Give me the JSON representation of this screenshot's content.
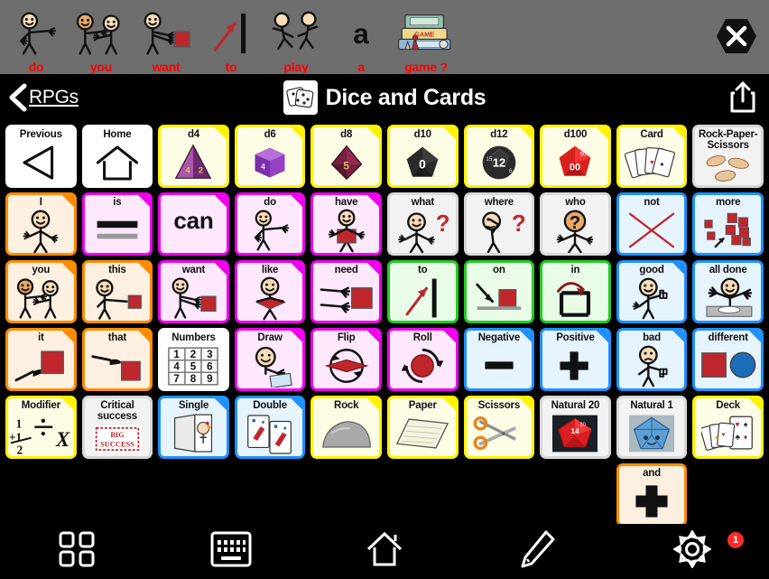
{
  "message_bar": {
    "words": [
      {
        "label": "do",
        "icon": "person-pointing-icon"
      },
      {
        "label": "you",
        "icon": "two-people-pointing-icon"
      },
      {
        "label": "want",
        "icon": "person-reaching-object-icon"
      },
      {
        "label": "to",
        "icon": "arrow-to-line-icon"
      },
      {
        "label": "play",
        "icon": "two-people-running-icon"
      },
      {
        "label": "a",
        "icon": "letter-a-icon"
      },
      {
        "label": "game ?",
        "icon": "board-games-stack-icon"
      }
    ],
    "close_button": "close-icon",
    "background_color": "#6e6e6e",
    "text_color": "#ff0000"
  },
  "navbar": {
    "back_label": "RPGs",
    "title": "Dice and Cards",
    "title_icon": "dice-icon",
    "share_icon": "share-icon"
  },
  "grid": {
    "rows": [
      [
        {
          "label": "Previous",
          "icon": "left-triangle-icon",
          "border": "#ffffff",
          "fill": "#ffffff",
          "fold": null
        },
        {
          "label": "Home",
          "icon": "house-outline-icon",
          "border": "#ffffff",
          "fill": "#ffffff",
          "fold": null
        },
        {
          "label": "d4",
          "icon": "d4-die-icon",
          "border": "#fff200",
          "fill": "#fdfce4",
          "fold": "#fff200"
        },
        {
          "label": "d6",
          "icon": "d6-die-icon",
          "border": "#fff200",
          "fill": "#fdfce4",
          "fold": "#fff200"
        },
        {
          "label": "d8",
          "icon": "d8-die-icon",
          "border": "#fff200",
          "fill": "#fdfce4",
          "fold": "#fff200"
        },
        {
          "label": "d10",
          "icon": "d10-die-icon",
          "border": "#fff200",
          "fill": "#fdfce4",
          "fold": "#fff200"
        },
        {
          "label": "d12",
          "icon": "d12-die-icon",
          "border": "#fff200",
          "fill": "#fdfce4",
          "fold": "#fff200"
        },
        {
          "label": "d100",
          "icon": "d100-die-icon",
          "border": "#fff200",
          "fill": "#fdfce4",
          "fold": "#fff200"
        },
        {
          "label": "Card",
          "icon": "playing-cards-fan-icon",
          "border": "#fff200",
          "fill": "#fdfce4",
          "fold": "#fff200"
        },
        {
          "label": "Rock-Paper-\nScissors",
          "icon": "hands-rps-icon",
          "border": "#d8d8d8",
          "fill": "#f2f2f2",
          "fold": null
        }
      ],
      [
        {
          "label": "I",
          "icon": "person-self-icon",
          "border": "#ff8c00",
          "fill": "#fdf0e0",
          "fold": "#ff8c00"
        },
        {
          "label": "is",
          "icon": "equals-sign-icon",
          "border": "#ee00ee",
          "fill": "#fde8fd",
          "fold": "#ee00ee"
        },
        {
          "label": "",
          "text": "can",
          "icon": "text-can-icon",
          "border": "#ee00ee",
          "fill": "#fde8fd",
          "fold": "#ee00ee"
        },
        {
          "label": "do",
          "icon": "person-pointing-icon",
          "border": "#ee00ee",
          "fill": "#fde8fd",
          "fold": "#ee00ee"
        },
        {
          "label": "have",
          "icon": "person-holding-block-icon",
          "border": "#ee00ee",
          "fill": "#fde8fd",
          "fold": "#ee00ee"
        },
        {
          "label": "what",
          "icon": "person-shrug-question-icon",
          "border": "#d8d8d8",
          "fill": "#f2f2f2",
          "fold": null
        },
        {
          "label": "where",
          "icon": "person-looking-question-icon",
          "border": "#d8d8d8",
          "fill": "#f2f2f2",
          "fold": null
        },
        {
          "label": "who",
          "icon": "person-question-head-icon",
          "border": "#d8d8d8",
          "fill": "#f2f2f2",
          "fold": null
        },
        {
          "label": "not",
          "icon": "red-x-icon",
          "border": "#1e90ff",
          "fill": "#e6f4ff",
          "fold": null
        },
        {
          "label": "more",
          "icon": "many-blocks-icon",
          "border": "#1e90ff",
          "fill": "#e6f4ff",
          "fold": null
        }
      ],
      [
        {
          "label": "you",
          "icon": "two-people-pointing-icon",
          "border": "#ff8c00",
          "fill": "#fdf0e0",
          "fold": "#ff8c00"
        },
        {
          "label": "this",
          "icon": "person-pointing-block-icon",
          "border": "#ff8c00",
          "fill": "#fdf0e0",
          "fold": "#ff8c00"
        },
        {
          "label": "want",
          "icon": "person-reaching-object-icon",
          "border": "#ee00ee",
          "fill": "#fde8fd",
          "fold": "#ee00ee"
        },
        {
          "label": "like",
          "icon": "person-hugging-block-icon",
          "border": "#ee00ee",
          "fill": "#fde8fd",
          "fold": "#ee00ee"
        },
        {
          "label": "need",
          "icon": "hands-reaching-block-icon",
          "border": "#ee00ee",
          "fill": "#fde8fd",
          "fold": "#ee00ee"
        },
        {
          "label": "to",
          "icon": "arrow-to-line-icon",
          "border": "#22cc22",
          "fill": "#e8fce8",
          "fold": null
        },
        {
          "label": "on",
          "icon": "arrow-on-block-icon",
          "border": "#22cc22",
          "fill": "#e8fce8",
          "fold": null
        },
        {
          "label": "in",
          "icon": "arrow-into-container-icon",
          "border": "#22cc22",
          "fill": "#e8fce8",
          "fold": null
        },
        {
          "label": "good",
          "icon": "person-thumbs-up-icon",
          "border": "#1e90ff",
          "fill": "#e6f4ff",
          "fold": "#1e90ff"
        },
        {
          "label": "all done",
          "icon": "person-empty-plate-icon",
          "border": "#1e90ff",
          "fill": "#e6f4ff",
          "fold": null
        }
      ],
      [
        {
          "label": "it",
          "icon": "hand-pointing-block-icon",
          "border": "#ff8c00",
          "fill": "#fdf0e0",
          "fold": "#ff8c00"
        },
        {
          "label": "that",
          "icon": "hand-pointing-far-block-icon",
          "border": "#ff8c00",
          "fill": "#fdf0e0",
          "fold": "#ff8c00"
        },
        {
          "label": "Numbers",
          "icon": "number-grid-icon",
          "border": "#ffffff",
          "fill": "#ffffff",
          "fold": null
        },
        {
          "label": "Draw",
          "icon": "person-drawing-card-icon",
          "border": "#ee00ee",
          "fill": "#fde8fd",
          "fold": "#ee00ee"
        },
        {
          "label": "Flip",
          "icon": "flip-arrows-icon",
          "border": "#ee00ee",
          "fill": "#fde8fd",
          "fold": "#ee00ee"
        },
        {
          "label": "Roll",
          "icon": "roll-arrows-icon",
          "border": "#ee00ee",
          "fill": "#fde8fd",
          "fold": "#ee00ee"
        },
        {
          "label": "Negative",
          "icon": "minus-sign-icon",
          "border": "#1e90ff",
          "fill": "#e6f4ff",
          "fold": "#1e90ff"
        },
        {
          "label": "Positive",
          "icon": "plus-sign-icon",
          "border": "#1e90ff",
          "fill": "#e6f4ff",
          "fold": "#1e90ff"
        },
        {
          "label": "bad",
          "icon": "person-thumbs-down-icon",
          "border": "#1e90ff",
          "fill": "#e6f4ff",
          "fold": "#1e90ff"
        },
        {
          "label": "different",
          "icon": "square-circle-icon",
          "border": "#1e90ff",
          "fill": "#e6f4ff",
          "fold": "#1e90ff"
        }
      ],
      [
        {
          "label": "Modifier",
          "icon": "math-symbols-icon",
          "border": "#fff200",
          "fill": "#fdfce4",
          "fold": "#fff200"
        },
        {
          "label": "Critical\nsuccess",
          "icon": "big-success-stamp-icon",
          "border": "#d8d8d8",
          "fill": "#f2f2f2",
          "fold": null
        },
        {
          "label": "Single",
          "icon": "single-card-icon",
          "border": "#1e90ff",
          "fill": "#e6f4ff",
          "fold": "#1e90ff"
        },
        {
          "label": "Double",
          "icon": "double-cards-icon",
          "border": "#1e90ff",
          "fill": "#e6f4ff",
          "fold": "#1e90ff"
        },
        {
          "label": "Rock",
          "icon": "rock-icon",
          "border": "#fff200",
          "fill": "#fdfce4",
          "fold": "#fff200"
        },
        {
          "label": "Paper",
          "icon": "paper-sheet-icon",
          "border": "#fff200",
          "fill": "#fdfce4",
          "fold": "#fff200"
        },
        {
          "label": "Scissors",
          "icon": "scissors-icon",
          "border": "#fff200",
          "fill": "#fdfce4",
          "fold": "#fff200"
        },
        {
          "label": "Natural 20",
          "icon": "red-d20-icon",
          "border": "#d8d8d8",
          "fill": "#f2f2f2",
          "fold": null
        },
        {
          "label": "Natural 1",
          "icon": "blue-d20-icon",
          "border": "#d8d8d8",
          "fill": "#f2f2f2",
          "fold": null
        },
        {
          "label": "Deck",
          "icon": "card-deck-icon",
          "border": "#fff200",
          "fill": "#fdfce4",
          "fold": "#fff200"
        }
      ],
      [
        {
          "empty": true
        },
        {
          "empty": true
        },
        {
          "empty": true
        },
        {
          "empty": true
        },
        {
          "empty": true
        },
        {
          "empty": true
        },
        {
          "empty": true
        },
        {
          "empty": true
        },
        {
          "label": "and",
          "icon": "plus-thick-icon",
          "border": "#ff8c00",
          "fill": "#fdf0e0",
          "fold": null
        },
        {
          "empty": true
        }
      ]
    ]
  },
  "toolbar": {
    "buttons": [
      {
        "name": "grid-icon",
        "label": "Grid"
      },
      {
        "name": "keyboard-icon",
        "label": "Keyboard"
      },
      {
        "name": "home-icon",
        "label": "Home"
      },
      {
        "name": "pencil-icon",
        "label": "Edit"
      },
      {
        "name": "gear-icon",
        "label": "Settings",
        "badge": "1"
      }
    ],
    "badge_color": "#fb2b2b"
  }
}
